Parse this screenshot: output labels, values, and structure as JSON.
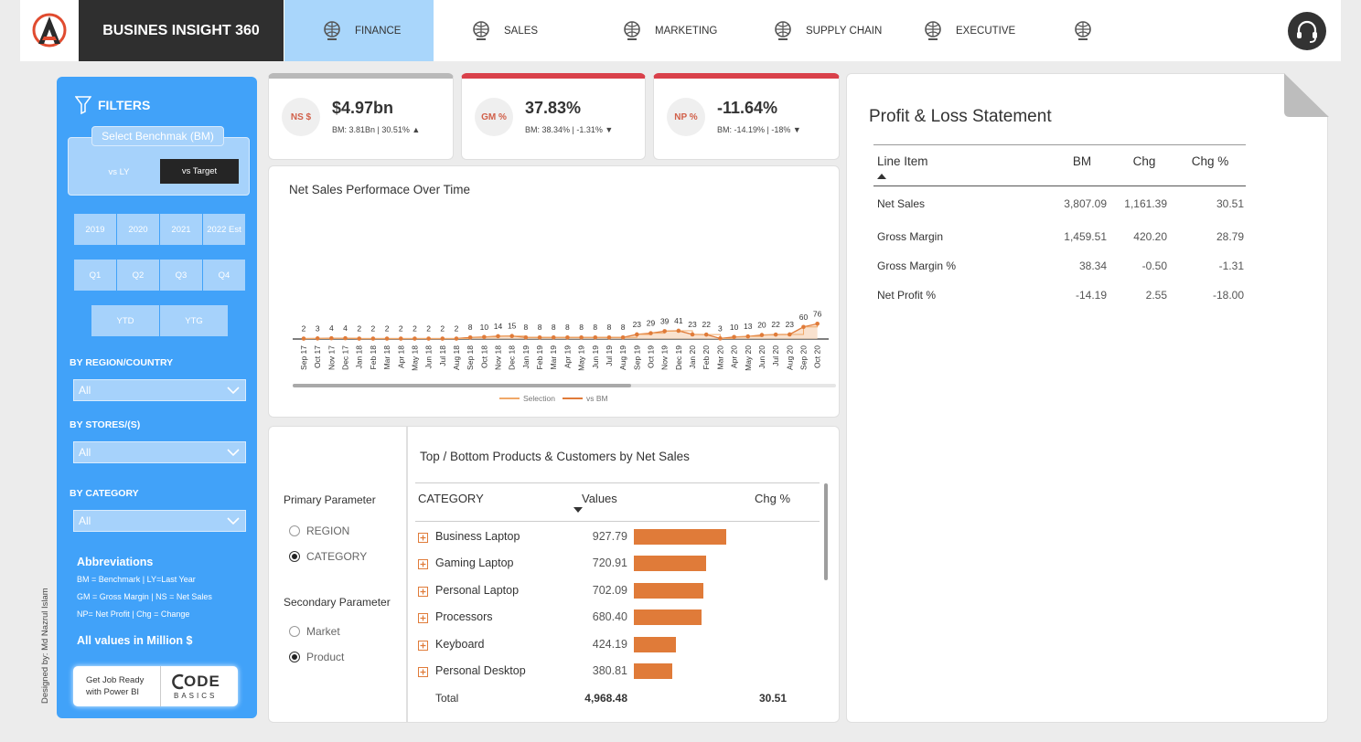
{
  "nav": {
    "brand": "BUSINES INSIGHT 360",
    "tabs": [
      {
        "label": "FINANCE",
        "active": true
      },
      {
        "label": "SALES"
      },
      {
        "label": "MARKETING"
      },
      {
        "label": "SUPPLY CHAIN"
      },
      {
        "label": "EXECUTIVE"
      },
      {
        "label": ""
      }
    ],
    "logo_icon": "company-logo-icon",
    "support_icon": "headset-support-icon"
  },
  "filters": {
    "title": "FILTERS",
    "benchmark_label": "Select Benchmak (BM)",
    "benchmark_options": [
      "vs LY",
      "vs Target"
    ],
    "benchmark_selected": "vs Target",
    "years": [
      "2019",
      "2020",
      "2021",
      "2022 Est"
    ],
    "quarters": [
      "Q1",
      "Q2",
      "Q3",
      "Q4"
    ],
    "period": [
      "YTD",
      "YTG"
    ],
    "region_label": "BY REGION/COUNTRY",
    "region_value": "All",
    "stores_label": "BY STORES/(S)",
    "stores_value": "All",
    "category_label": "BY CATEGORY",
    "category_value": "All",
    "abbr_title": "Abbreviations",
    "abbr_lines": [
      "BM = Benchmark | LY=Last Year",
      "GM = Gross Margin | NS = Net Sales",
      "NP= Net Profit | Chg = Change"
    ],
    "units_note": "All values in Million $",
    "promo_text_1": "Get Job Ready",
    "promo_text_2": "with Power BI",
    "promo_logo_1": "ODE",
    "promo_logo_2": "BASICS"
  },
  "designer": "Designed by: Md Nazrul Islam",
  "kpis": [
    {
      "badge": "NS $",
      "value": "$4.97bn",
      "bm": "BM: 3.81Bn | 30.51%",
      "arrow": "▲",
      "accent": "#b9b9b9"
    },
    {
      "badge": "GM %",
      "value": "37.83%",
      "bm": "BM: 38.34% | -1.31%",
      "arrow": "▼",
      "accent": "#d9404a"
    },
    {
      "badge": "NP %",
      "value": "-11.64%",
      "bm": "BM: -14.19% | -18%",
      "arrow": "▼",
      "accent": "#d9404a"
    }
  ],
  "chart_data": {
    "type": "line",
    "title": "Net Sales Performace Over Time",
    "x": [
      "Sep 17",
      "Oct 17",
      "Nov 17",
      "Dec 17",
      "Jan 18",
      "Feb 18",
      "Mar 18",
      "Apr 18",
      "May 18",
      "Jun 18",
      "Jul 18",
      "Aug 18",
      "Sep 18",
      "Oct 18",
      "Nov 18",
      "Dec 18",
      "Jan 19",
      "Feb 19",
      "Mar 19",
      "Apr 19",
      "May 19",
      "Jun 19",
      "Jul 19",
      "Aug 19",
      "Sep 19",
      "Oct 19",
      "Nov 19",
      "Dec 19",
      "Jan 20",
      "Feb 20",
      "Mar 20",
      "Apr 20",
      "May 20",
      "Jun 20",
      "Jul 20",
      "Aug 20",
      "Sep 20",
      "Oct 20"
    ],
    "series": [
      {
        "name": "Selection",
        "values": [
          2,
          3,
          4,
          4,
          2,
          2,
          2,
          2,
          2,
          2,
          2,
          2,
          8,
          10,
          14,
          15,
          8,
          8,
          8,
          8,
          8,
          8,
          8,
          8,
          23,
          29,
          39,
          41,
          23,
          22,
          3,
          10,
          13,
          20,
          22,
          23,
          60,
          76
        ]
      },
      {
        "name": "vs BM",
        "values": [
          2,
          3,
          4,
          4,
          2,
          2,
          2,
          2,
          2,
          2,
          2,
          2,
          8,
          10,
          14,
          15,
          8,
          8,
          8,
          8,
          8,
          8,
          8,
          8,
          23,
          29,
          39,
          41,
          23,
          22,
          3,
          10,
          13,
          20,
          22,
          23,
          60,
          76
        ]
      }
    ],
    "legend": [
      "Selection",
      "vs BM"
    ],
    "colors": {
      "selection": "#f0a868",
      "bm": "#e07b39"
    }
  },
  "params": {
    "primary_label": "Primary Parameter",
    "primary_options": [
      "REGION",
      "CATEGORY"
    ],
    "primary_selected": "CATEGORY",
    "secondary_label": "Secondary Parameter",
    "secondary_options": [
      "Market",
      "Product"
    ],
    "secondary_selected": "Product"
  },
  "topbottom": {
    "title": "Top / Bottom Products & Customers by Net Sales",
    "headers": [
      "CATEGORY",
      "Values",
      "Chg %"
    ],
    "rows": [
      {
        "name": "Business Laptop",
        "value": "927.79",
        "num": 927.79
      },
      {
        "name": "Gaming Laptop",
        "value": "720.91",
        "num": 720.91
      },
      {
        "name": "Personal Laptop",
        "value": "702.09",
        "num": 702.09
      },
      {
        "name": "Processors",
        "value": "680.40",
        "num": 680.4
      },
      {
        "name": "Keyboard",
        "value": "424.19",
        "num": 424.19
      },
      {
        "name": "Personal Desktop",
        "value": "380.81",
        "num": 380.81
      }
    ],
    "total_label": "Total",
    "total_value": "4,968.48",
    "total_chg": "30.51",
    "bar_color": "#e07b39"
  },
  "pl": {
    "title": "Profit & Loss Statement",
    "headers": [
      "Line Item",
      "BM",
      "Chg",
      "Chg %"
    ],
    "rows": [
      [
        "Net Sales",
        "3,807.09",
        "1,161.39",
        "30.51"
      ],
      [
        "Gross Margin",
        "1,459.51",
        "420.20",
        "28.79"
      ],
      [
        "Gross Margin %",
        "38.34",
        "-0.50",
        "-1.31"
      ],
      [
        "Net Profit %",
        "-14.19",
        "2.55",
        "-18.00"
      ]
    ]
  }
}
